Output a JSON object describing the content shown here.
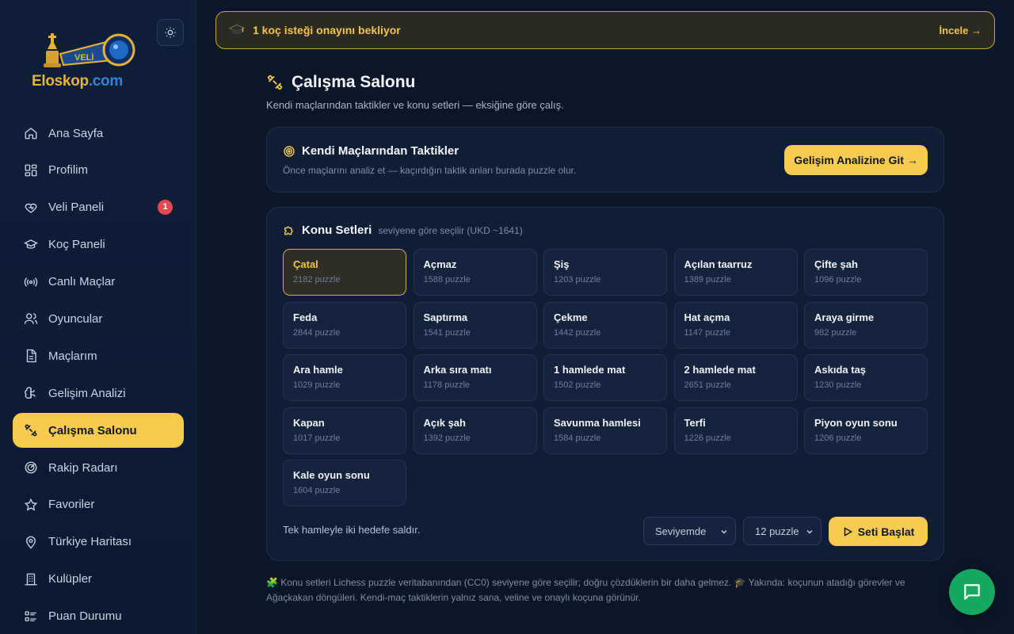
{
  "sidebar": {
    "logo_alt": "Eloskop.com",
    "logo_text_a": "Eloskop",
    "logo_text_b": ".com",
    "theme_toggle_icon": "sun-icon",
    "items": [
      {
        "label": "Ana Sayfa",
        "icon": "home-icon"
      },
      {
        "label": "Profilim",
        "icon": "grid-icon"
      },
      {
        "label": "Veli Paneli",
        "icon": "heart-icon",
        "badge": "1"
      },
      {
        "label": "Koç Paneli",
        "icon": "graduation-cap-icon"
      },
      {
        "label": "Canlı Maçlar",
        "icon": "broadcast-icon"
      },
      {
        "label": "Oyuncular",
        "icon": "users-icon"
      },
      {
        "label": "Maçlarım",
        "icon": "document-icon"
      },
      {
        "label": "Gelişim Analizi",
        "icon": "brain-icon"
      },
      {
        "label": "Çalışma Salonu",
        "icon": "dumbbell-icon",
        "active": true
      },
      {
        "label": "Rakip Radarı",
        "icon": "radar-icon"
      },
      {
        "label": "Favoriler",
        "icon": "star-icon"
      },
      {
        "label": "Türkiye Haritası",
        "icon": "map-pin-icon"
      },
      {
        "label": "Kulüpler",
        "icon": "building-icon"
      },
      {
        "label": "Puan Durumu",
        "icon": "list-icon"
      }
    ]
  },
  "banner": {
    "text": "1 koç isteği onayını bekliyor",
    "link": "İncele →"
  },
  "page": {
    "title": "Çalışma Salonu",
    "subtitle": "Kendi maçlarından taktikler ve konu setleri — eksiğine göre çalış."
  },
  "tactics_card": {
    "title": "Kendi Maçlarından Taktikler",
    "subtitle": "Önce maçlarını analiz et — kaçırdığın taktik anları burada puzzle olur.",
    "button": "Gelişim Analizine Git →"
  },
  "topics_card": {
    "title": "Konu Setleri",
    "hint": "seviyene göre seçilir (UKD ~1641)",
    "topics": [
      {
        "name": "Çatal",
        "count": "2182 puzzle",
        "selected": true
      },
      {
        "name": "Açmaz",
        "count": "1588 puzzle"
      },
      {
        "name": "Şiş",
        "count": "1203 puzzle"
      },
      {
        "name": "Açılan taarruz",
        "count": "1389 puzzle"
      },
      {
        "name": "Çifte şah",
        "count": "1096 puzzle"
      },
      {
        "name": "Feda",
        "count": "2844 puzzle"
      },
      {
        "name": "Saptırma",
        "count": "1541 puzzle"
      },
      {
        "name": "Çekme",
        "count": "1442 puzzle"
      },
      {
        "name": "Hat açma",
        "count": "1147 puzzle"
      },
      {
        "name": "Araya girme",
        "count": "982 puzzle"
      },
      {
        "name": "Ara hamle",
        "count": "1029 puzzle"
      },
      {
        "name": "Arka sıra matı",
        "count": "1178 puzzle"
      },
      {
        "name": "1 hamlede mat",
        "count": "1502 puzzle"
      },
      {
        "name": "2 hamlede mat",
        "count": "2651 puzzle"
      },
      {
        "name": "Askıda taş",
        "count": "1230 puzzle"
      },
      {
        "name": "Kapan",
        "count": "1017 puzzle"
      },
      {
        "name": "Açık şah",
        "count": "1392 puzzle"
      },
      {
        "name": "Savunma hamlesi",
        "count": "1584 puzzle"
      },
      {
        "name": "Terfi",
        "count": "1226 puzzle"
      },
      {
        "name": "Piyon oyun sonu",
        "count": "1206 puzzle"
      },
      {
        "name": "Kale oyun sonu",
        "count": "1604 puzzle"
      }
    ],
    "description": "Tek hamleyle iki hedefe saldır.",
    "level_select": "Seviyemde",
    "count_select": "12 puzzle",
    "start_button": "Seti Başlat"
  },
  "footnote": "🧩 Konu setleri Lichess puzzle veritabanından (CC0) seviyene göre seçilir; doğru çözdüklerin bir daha gelmez. 🎓 Yakında: koçunun atadığı görevler ve Ağaçkakan döngüleri. Kendi-maç taktiklerin yalnız sana, veline ve onaylı koçuna görünür.",
  "colors": {
    "accent": "#f6cb4f",
    "background": "#0b1628",
    "card": "#0f1e35",
    "chat": "#17a85f",
    "badge": "#e5484d"
  }
}
